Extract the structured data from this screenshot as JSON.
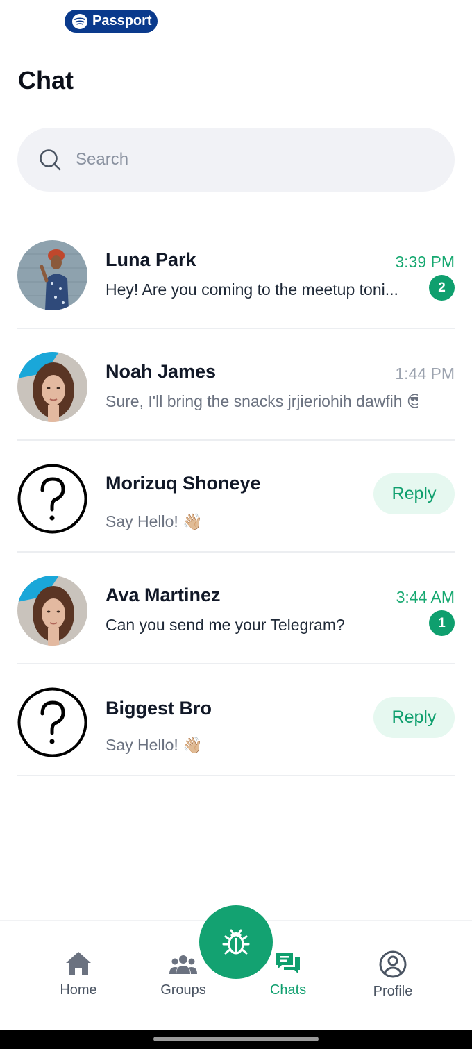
{
  "badge": {
    "label": "Passport",
    "icon": "spotify-icon"
  },
  "page": {
    "title": "Chat"
  },
  "search": {
    "placeholder": "Search",
    "icon": "search-icon"
  },
  "chats": [
    {
      "name": "Luna Park",
      "message": "Hey! Are you coming to the meetup toni...",
      "time": "3:39 PM",
      "unread": "2",
      "avatar": "photo-woman-red-hair"
    },
    {
      "name": "Noah James",
      "message": "Sure, I'll bring the snacks jrjieriohih dawfih 😎",
      "time": "1:44 PM",
      "avatar": "photo-woman-brown-hair"
    },
    {
      "name": "Morizuq Shoneye",
      "message": "Say Hello! 👋🏼",
      "action": "Reply",
      "avatar": "question-mark-icon"
    },
    {
      "name": "Ava Martinez",
      "message": "Can you send me your Telegram?",
      "time": "3:44 AM",
      "unread": "1",
      "avatar": "photo-woman-brown-hair"
    },
    {
      "name": "Biggest Bro",
      "message": "Say Hello! 👋🏼",
      "action": "Reply",
      "avatar": "question-mark-icon"
    }
  ],
  "nav": {
    "items": [
      {
        "label": "Home",
        "icon": "home-icon"
      },
      {
        "label": "Groups",
        "icon": "groups-icon"
      },
      {
        "label": "Chats",
        "icon": "chats-icon",
        "active": true
      },
      {
        "label": "Profile",
        "icon": "profile-icon"
      }
    ],
    "fab_icon": "bug-icon"
  },
  "colors": {
    "accent": "#0f9f6e",
    "badge_bg": "#0a3a8c",
    "search_bg": "#f1f2f6",
    "reply_bg": "#e6f8f0"
  }
}
